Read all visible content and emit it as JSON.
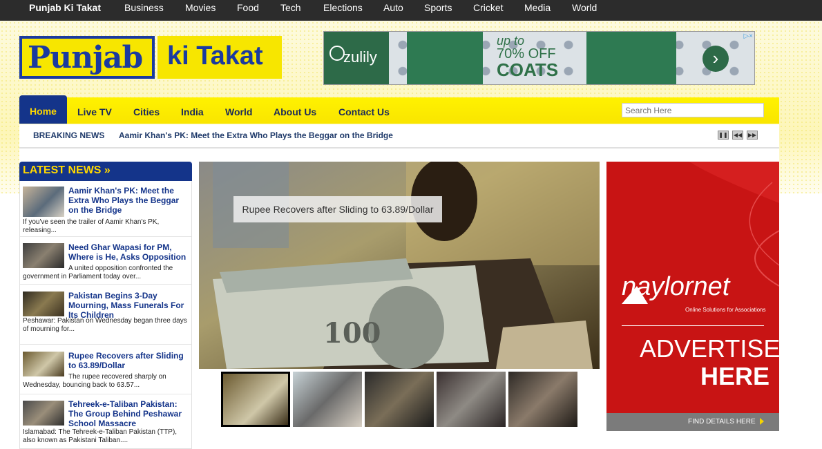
{
  "topnav": {
    "brand": "Punjab Ki Takat",
    "items": [
      "Business",
      "Movies",
      "Food",
      "Tech",
      "Elections",
      "Auto",
      "Sports",
      "Cricket",
      "Media",
      "World"
    ]
  },
  "logo": {
    "part1": "Punjab",
    "part2": "ki Takat"
  },
  "banner_ad": {
    "brand": "zulily",
    "line1": "up to",
    "line2": "70% OFF",
    "line3": "COATS",
    "badge": "▷×"
  },
  "mainnav": {
    "home": "Home",
    "items": [
      "Live TV",
      "Cities",
      "India",
      "World",
      "About Us",
      "Contact Us"
    ],
    "search_placeholder": "Search Here"
  },
  "breaking": {
    "label": "BREAKING NEWS",
    "headline": "Aamir Khan's PK: Meet the Extra Who Plays the Beggar on the Bridge",
    "controls": [
      "pause-icon",
      "prev-icon",
      "next-icon"
    ]
  },
  "latest": {
    "heading": "LATEST NEWS »",
    "items": [
      {
        "title": "Aamir Khan's PK: Meet the Extra Who Plays the Beggar on the Bridge",
        "desc": "If you've seen the trailer of Aamir Khan's PK, releasing..."
      },
      {
        "title": "Need Ghar Wapasi for PM, Where is He, Asks Opposition",
        "desc": "A united opposition confronted the government in Parliament today over..."
      },
      {
        "title": "Pakistan Begins 3-Day Mourning, Mass Funerals For Its Children",
        "desc": "Peshawar: Pakistan on Wednesday began three days of mourning for..."
      },
      {
        "title": "Rupee Recovers after Sliding to 63.89/Dollar",
        "desc": "The rupee recovered sharply on Wednesday, bouncing back to 63.57..."
      },
      {
        "title": "Tehreek-e-Taliban Pakistan: The Group Behind Peshawar School Massacre",
        "desc": "Islamabad: The Tehreek-e-Taliban Pakistan (TTP), also known as Pakistani Taliban...."
      }
    ]
  },
  "slider": {
    "caption": "Rupee Recovers after Sliding to 63.89/Dollar",
    "note_text": "100"
  },
  "right_ad": {
    "brand": "naylornet",
    "tagline": "Online Solutions for Associations",
    "line1": "ADVERTISE",
    "line2": "HERE",
    "cta": "FIND DETAILS HERE"
  }
}
